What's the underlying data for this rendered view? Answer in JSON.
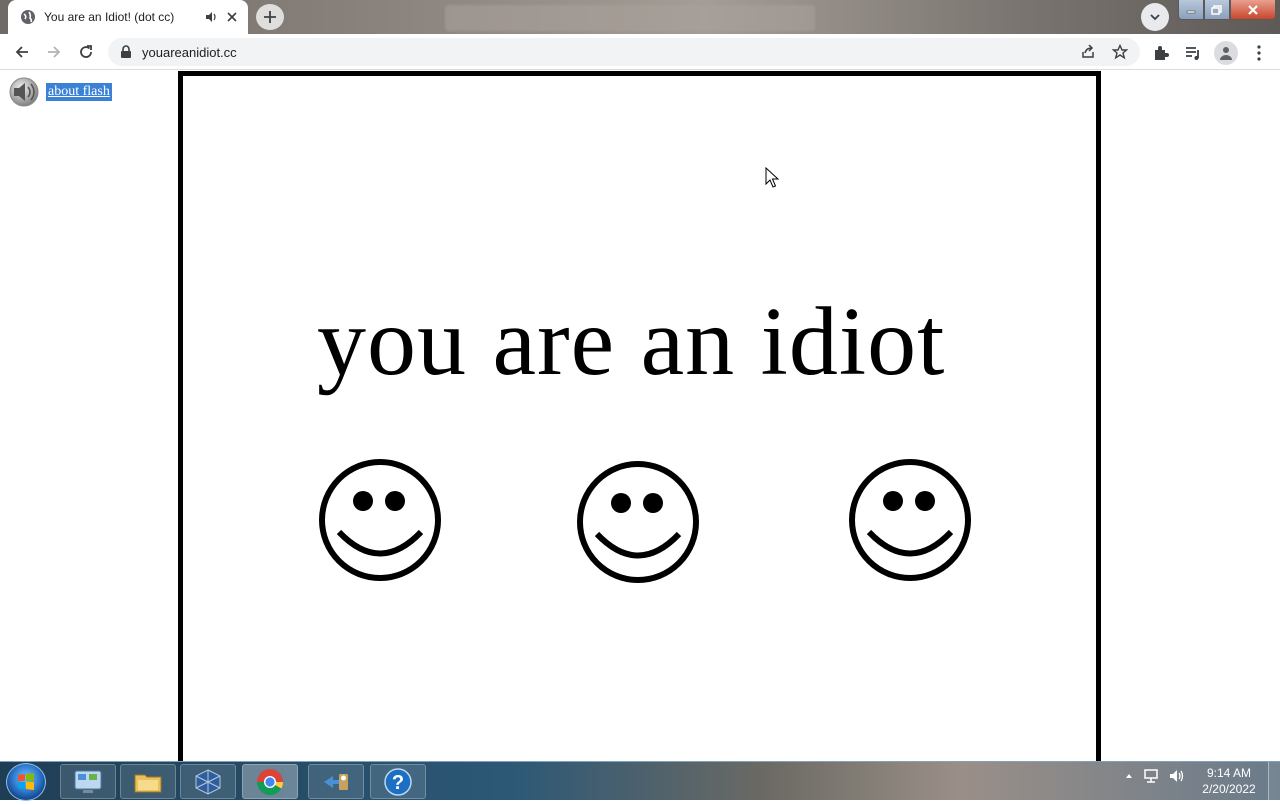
{
  "browser": {
    "tab": {
      "title": "You are an Idiot! (dot cc)"
    },
    "address_bar": {
      "url": "youareanidiot.cc"
    }
  },
  "page": {
    "flash_link": {
      "label": "about flash"
    },
    "headline": "you are an idiot",
    "smiley_count": 3
  },
  "taskbar": {
    "apps": [
      "control-panel-icon",
      "file-explorer-icon",
      "virtualbox-icon",
      "chrome-icon",
      "migration-wizard-icon",
      "help-icon"
    ],
    "clock": {
      "time": "9:14 AM",
      "date": "2/20/2022"
    }
  },
  "colors": {
    "flash_label_bg": "#3b82d6",
    "tab_bg": "#ffffff",
    "frame": "#000000"
  }
}
